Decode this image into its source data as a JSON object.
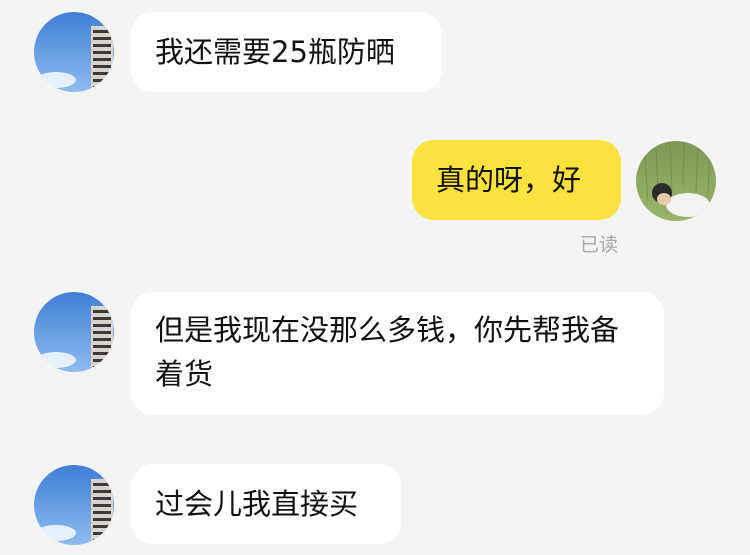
{
  "colors": {
    "background": "#f4f4f4",
    "incoming_bubble": "#ffffff",
    "outgoing_bubble": "#fbe23f",
    "text": "#111111",
    "read_receipt": "#a8a8a8"
  },
  "messages": [
    {
      "direction": "incoming",
      "text": "我还需要25瓶防晒",
      "avatar": "building-sky-avatar"
    },
    {
      "direction": "outgoing",
      "text": "真的呀，好",
      "status": "已读",
      "avatar": "grass-field-avatar"
    },
    {
      "direction": "incoming",
      "text": "但是我现在没那么多钱，你先帮我备着货",
      "avatar": "building-sky-avatar"
    },
    {
      "direction": "incoming",
      "text": "过会儿我直接买",
      "avatar": "building-sky-avatar"
    }
  ]
}
